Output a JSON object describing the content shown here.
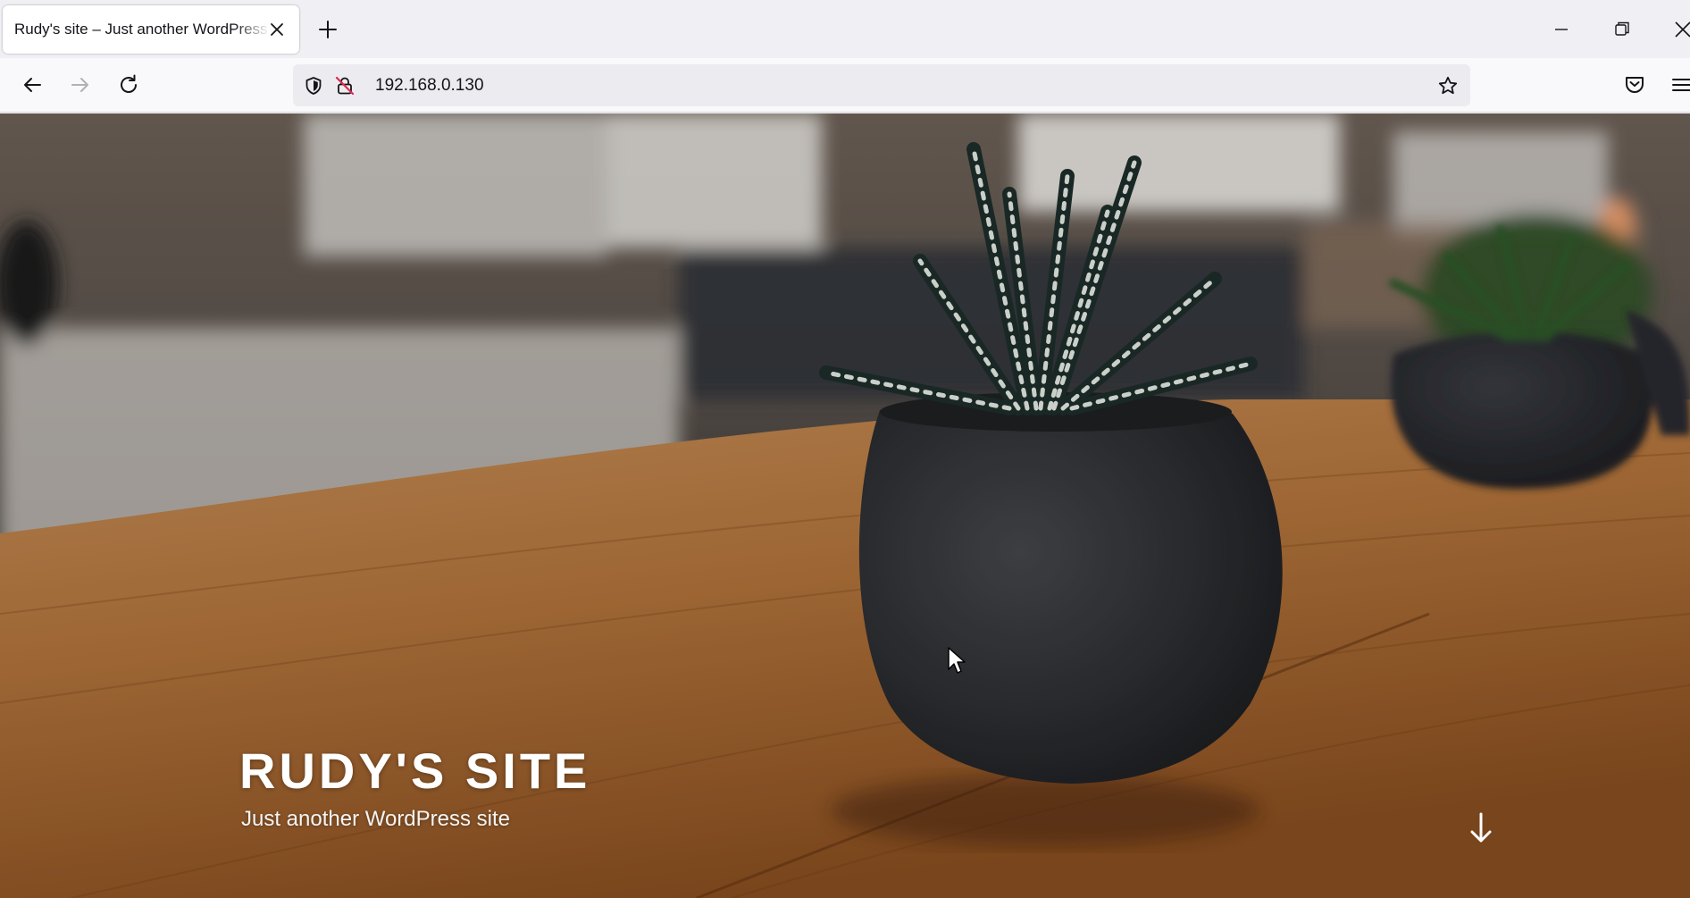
{
  "browser": {
    "tab_title": "Rudy's site – Just another WordPress site",
    "url": "192.168.0.130",
    "icons": {
      "close_tab": "close-icon",
      "new_tab": "plus-icon",
      "back": "arrow-left-icon",
      "forward": "arrow-right-icon",
      "reload": "reload-icon",
      "tracking": "shield-icon",
      "insecure": "lock-insecure-icon",
      "bookmark": "star-icon",
      "pocket": "pocket-icon",
      "menu": "hamburger-menu-icon",
      "minimize": "minimize-icon",
      "restore": "restore-icon",
      "close_window": "close-icon"
    }
  },
  "page": {
    "site_title": "RUDY'S SITE",
    "site_description": "Just another WordPress site",
    "scroll_icon": "arrow-down-icon"
  },
  "colors": {
    "chrome_bg": "#f0f0f4",
    "urlbar_bg": "#ececf0",
    "title_text": "#ffffff",
    "table_wood": "#b06b2c",
    "pot": "#2f3135"
  }
}
